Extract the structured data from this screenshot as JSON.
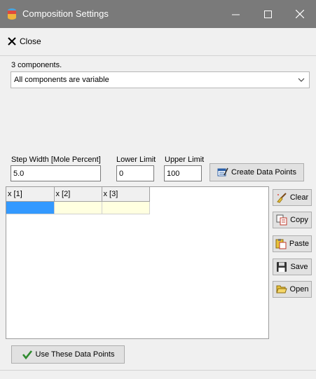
{
  "window": {
    "title": "Composition Settings",
    "titlebar_color": "#7a7a7a",
    "minimize_glyph": "—",
    "maximize_glyph": "☐",
    "close_glyph": "✕"
  },
  "toolbar": {
    "close_label": "Close",
    "close_icon": "x-icon"
  },
  "components": {
    "count_text": "3 components.",
    "mode_selected": "All components are variable"
  },
  "params": {
    "step_label": "Step Width [Mole Percent]",
    "step_value": "5.0",
    "lower_label": "Lower Limit",
    "lower_value": "0",
    "upper_label": "Upper Limit",
    "upper_value": "100",
    "create_label": "Create Data Points"
  },
  "grid": {
    "columns": [
      "x [1]",
      "x [2]",
      "x [3]"
    ],
    "rows": [
      [
        "",
        "",
        ""
      ]
    ],
    "selected_cell_color": "#3399ff",
    "cell_color": "#ffffe0"
  },
  "side_buttons": {
    "clear": "Clear",
    "copy": "Copy",
    "paste": "Paste",
    "save": "Save",
    "open": "Open"
  },
  "footer": {
    "use_label": "Use These Data Points"
  }
}
